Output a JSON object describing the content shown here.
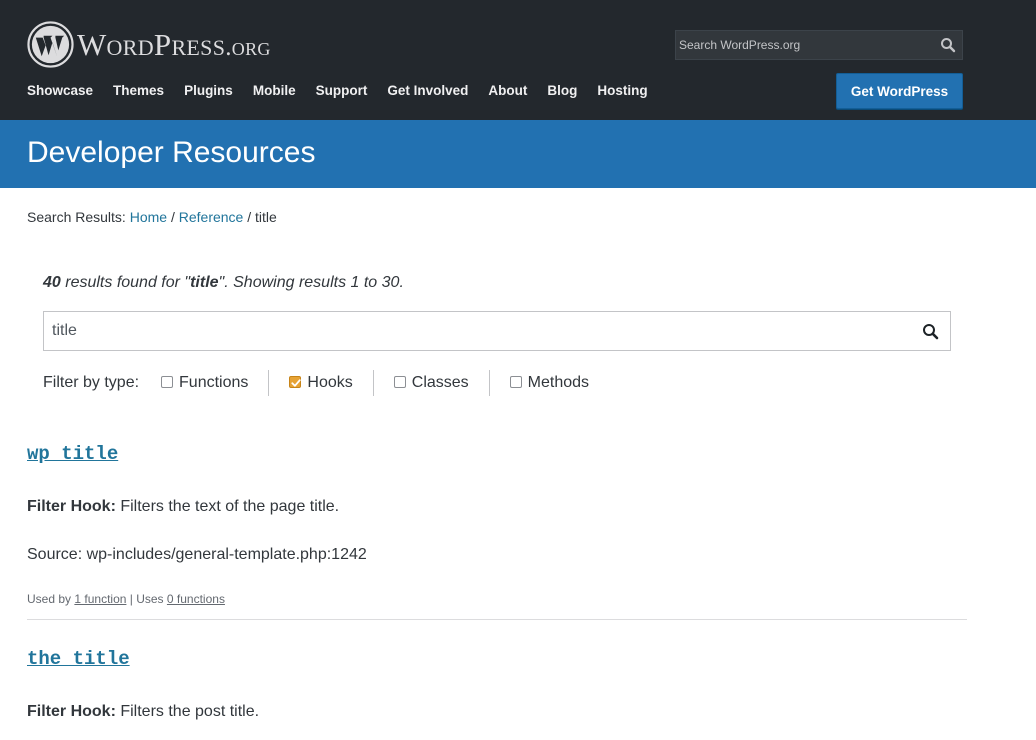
{
  "header": {
    "logo_main": "WordPress",
    "logo_suffix": ".org",
    "search_placeholder": "Search WordPress.org",
    "nav": [
      "Showcase",
      "Themes",
      "Plugins",
      "Mobile",
      "Support",
      "Get Involved",
      "About",
      "Blog",
      "Hosting"
    ],
    "get_wordpress_label": "Get WordPress"
  },
  "banner": {
    "title": "Developer Resources"
  },
  "breadcrumb": {
    "prefix": "Search Results:",
    "home": "Home",
    "sep1": "/",
    "reference": "Reference",
    "sep2": "/",
    "current": "title"
  },
  "results": {
    "count": "40",
    "summary_mid": " results found for \"",
    "query": "title",
    "summary_end": "\". Showing results 1 to 30.",
    "search_value": "title"
  },
  "filter": {
    "label": "Filter by type:",
    "options": [
      {
        "label": "Functions",
        "checked": false
      },
      {
        "label": "Hooks",
        "checked": true
      },
      {
        "label": "Classes",
        "checked": false
      },
      {
        "label": "Methods",
        "checked": false
      }
    ]
  },
  "items": [
    {
      "title": "wp_title",
      "type_label": "Filter Hook:",
      "description": "Filters the text of the page title.",
      "source": "Source: wp-includes/general-template.php:1242",
      "used_by_prefix": "Used by",
      "used_by_link": "1 function",
      "uses_sep": "| Uses",
      "uses_link": "0 functions"
    },
    {
      "title": "the_title",
      "type_label": "Filter Hook:",
      "description": "Filters the post title."
    }
  ],
  "colors": {
    "header_bg": "#23282d",
    "banner_bg": "#2271b1",
    "link": "#21759b",
    "checkbox_checked": "#e7a335"
  }
}
